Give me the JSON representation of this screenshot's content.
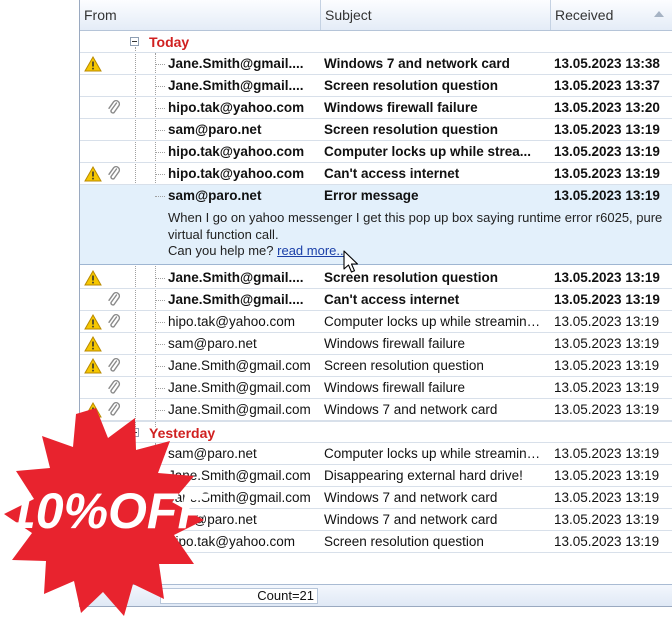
{
  "columns": {
    "from": "From",
    "subject": "Subject",
    "received": "Received"
  },
  "groups": {
    "today": "Today",
    "yesterday": "Yesterday"
  },
  "rows_today_top": [
    {
      "from": "Jane.Smith@gmail....",
      "subject": "Windows 7 and network card",
      "received": "13.05.2023 13:38",
      "warn": true,
      "clip": false,
      "bold": true
    },
    {
      "from": "Jane.Smith@gmail....",
      "subject": "Screen resolution question",
      "received": "13.05.2023 13:37",
      "warn": false,
      "clip": false,
      "bold": true
    },
    {
      "from": "hipo.tak@yahoo.com",
      "subject": "Windows firewall failure",
      "received": "13.05.2023 13:20",
      "warn": false,
      "clip": true,
      "bold": true
    },
    {
      "from": "sam@paro.net",
      "subject": "Screen resolution question",
      "received": "13.05.2023 13:19",
      "warn": false,
      "clip": false,
      "bold": true
    },
    {
      "from": "hipo.tak@yahoo.com",
      "subject": "Computer locks up while strea...",
      "received": "13.05.2023 13:19",
      "warn": false,
      "clip": false,
      "bold": true
    },
    {
      "from": "hipo.tak@yahoo.com",
      "subject": "Can't access internet",
      "received": "13.05.2023 13:19",
      "warn": true,
      "clip": true,
      "bold": true
    }
  ],
  "selected_row": {
    "from": "sam@paro.net",
    "subject": "Error message",
    "received": "13.05.2023 13:19"
  },
  "preview": {
    "line1": "When I go on yahoo messenger I get this pop up box saying runtime error r6025, pure virtual function call.",
    "line2": "Can you help me?",
    "link": "read more..."
  },
  "rows_today_bottom": [
    {
      "from": "Jane.Smith@gmail....",
      "subject": "Screen resolution question",
      "received": "13.05.2023 13:19",
      "warn": true,
      "clip": false,
      "bold": true
    },
    {
      "from": "Jane.Smith@gmail....",
      "subject": "Can't access internet",
      "received": "13.05.2023 13:19",
      "warn": false,
      "clip": true,
      "bold": true
    },
    {
      "from": "hipo.tak@yahoo.com",
      "subject": "Computer locks up while streaming ...",
      "received": "13.05.2023 13:19",
      "warn": true,
      "clip": true,
      "bold": false
    },
    {
      "from": "sam@paro.net",
      "subject": "Windows firewall failure",
      "received": "13.05.2023 13:19",
      "warn": true,
      "clip": false,
      "bold": false
    },
    {
      "from": "Jane.Smith@gmail.com",
      "subject": "Screen resolution question",
      "received": "13.05.2023 13:19",
      "warn": true,
      "clip": true,
      "bold": false
    },
    {
      "from": "Jane.Smith@gmail.com",
      "subject": "Windows firewall failure",
      "received": "13.05.2023 13:19",
      "warn": false,
      "clip": true,
      "bold": false
    },
    {
      "from": "Jane.Smith@gmail.com",
      "subject": "Windows 7 and network card",
      "received": "13.05.2023 13:19",
      "warn": true,
      "clip": true,
      "bold": false
    }
  ],
  "rows_yesterday": [
    {
      "from": "sam@paro.net",
      "subject": "Computer locks up while streaming ...",
      "received": "13.05.2023 13:19",
      "warn": false,
      "clip": false,
      "bold": false
    },
    {
      "from": "Jane.Smith@gmail.com",
      "subject": "Disappearing external hard drive!",
      "received": "13.05.2023 13:19",
      "warn": false,
      "clip": false,
      "bold": false
    },
    {
      "from": "Jane.Smith@gmail.com",
      "subject": "Windows 7 and network card",
      "received": "13.05.2023 13:19",
      "warn": false,
      "clip": false,
      "bold": false
    },
    {
      "from": "sam@paro.net",
      "subject": "Windows 7 and network card",
      "received": "13.05.2023 13:19",
      "warn": false,
      "clip": false,
      "bold": false
    },
    {
      "from": "hipo.tak@yahoo.com",
      "subject": "Screen resolution question",
      "received": "13.05.2023 13:19",
      "warn": false,
      "clip": false,
      "bold": false
    }
  ],
  "footer": {
    "count": "Count=21"
  },
  "promo": {
    "text": "10%OFF"
  },
  "colors": {
    "group_label": "#d02020",
    "promo_red": "#e8232e",
    "selection": "#e3f0fb"
  },
  "icons": {
    "warning": "warning-icon",
    "attachment": "paperclip-icon",
    "expander": "collapse-icon",
    "sort": "sort-ascending-icon"
  }
}
